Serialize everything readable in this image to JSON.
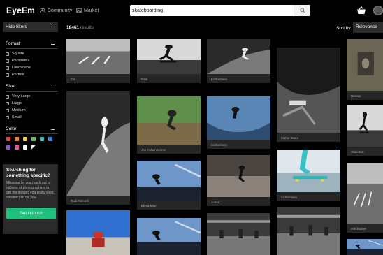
{
  "header": {
    "logo": "EyeEm",
    "nav": [
      {
        "label": "Community",
        "icon": "people-icon"
      },
      {
        "label": "Market",
        "icon": "picture-icon"
      }
    ],
    "search": {
      "value": "skateboarding",
      "placeholder": "Search"
    }
  },
  "sidebar": {
    "hide_filters_label": "Hide filters",
    "format": {
      "title": "Format",
      "options": [
        "Square",
        "Panorama",
        "Landscape",
        "Portrait"
      ]
    },
    "size": {
      "title": "Size",
      "options": [
        "Very Large",
        "Large",
        "Medium",
        "Small"
      ]
    },
    "color": {
      "title": "Color",
      "swatches": [
        "#e0463f",
        "#f08a3a",
        "#f1cf3e",
        "#6fbf73",
        "#3fbfbf",
        "#3a8fd9",
        "#8a5cd1",
        "#e85fa0",
        "#ffffff",
        "#bfbfbf"
      ]
    },
    "promo": {
      "title": "Searching for something specific?",
      "text": "Missions let you reach out to millions of photographers to get the images you really want, created just for you.",
      "button": "Get in touch"
    }
  },
  "results": {
    "count": "18461",
    "count_suffix": "results",
    "sort_label": "Sort by",
    "sort_value": "Relevance"
  },
  "photos": [
    {
      "author": "Cat"
    },
    {
      "author": "Kate"
    },
    {
      "author": "Lichtenhein"
    },
    {
      "author": "Mattie Bruce"
    },
    {
      "author": "Renato"
    },
    {
      "author": "Rudi Reimelt"
    },
    {
      "author": "Jan Hohenheimer"
    },
    {
      "author": "Lichtenhein"
    },
    {
      "author": "Oldenfort"
    },
    {
      "author": "Elena Mari"
    },
    {
      "author": "Junior"
    },
    {
      "author": "Lichtenhein"
    },
    {
      "author": "erik lindner"
    },
    {
      "author": ""
    },
    {
      "author": ""
    },
    {
      "author": ""
    },
    {
      "author": ""
    },
    {
      "author": ""
    }
  ]
}
